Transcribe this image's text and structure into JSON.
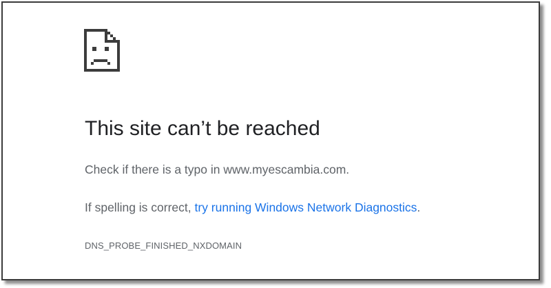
{
  "error_page": {
    "icon": "sad-page-icon",
    "title": "This site can’t be reached",
    "hint_line": "Check if there is a typo in www.myescambia.com.",
    "spelling_prefix": "If spelling is correct, ",
    "diagnostics_link": "try running Windows Network Diagnostics",
    "spelling_suffix": ".",
    "error_code": "DNS_PROBE_FINISHED_NXDOMAIN"
  },
  "colors": {
    "title": "#202124",
    "body_text": "#5f6368",
    "link": "#1a73e8"
  }
}
